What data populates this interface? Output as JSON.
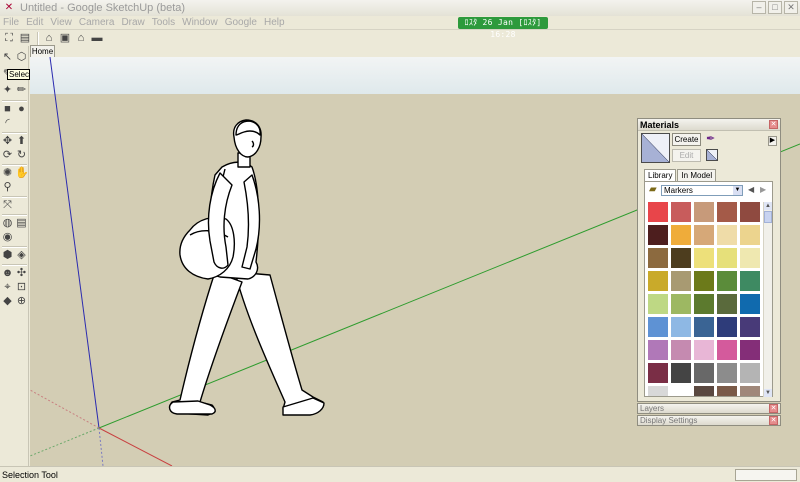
{
  "window": {
    "title": "Untitled - Google SketchUp (beta)",
    "icon": "sketchup-logo-icon",
    "buttons": [
      "minimize-icon",
      "maximize-icon",
      "close-icon"
    ]
  },
  "menubar": [
    "File",
    "Edit",
    "View",
    "Camera",
    "Draw",
    "Tools",
    "Window",
    "Google",
    "Help"
  ],
  "clock": "ﾛｽﾀ 26 Jan  [ﾛｽﾀ]  16:28",
  "scene_tabs": [
    "Home"
  ],
  "tooltip": "Select",
  "statusbar": {
    "text": "Selection Tool",
    "measurements_value": ""
  },
  "colors": {
    "ground": "#d3cdb4",
    "sky": "#dfe9ec",
    "red_axis": "#c84040",
    "green_axis": "#2e9c2e",
    "blue_axis": "#2b2bb0",
    "clock_bg": "#2d9a3c"
  },
  "materials": {
    "title": "Materials",
    "create_label": "Create",
    "edit_label": "Edit",
    "tabs": [
      "Library",
      "In Model"
    ],
    "active_tab": "Library",
    "collection": "Markers",
    "swatches": [
      "#e8454a",
      "#c85c5c",
      "#c79a7a",
      "#a45a48",
      "#8f4a40",
      "#4d1e1e",
      "#efac3a",
      "#d6a878",
      "#efdca8",
      "#ecd48e",
      "#8c6a3f",
      "#4d3d1e",
      "#ede07a",
      "#e6e07a",
      "#efe8b0",
      "#c9aa2a",
      "#a89a72",
      "#6c7a1a",
      "#5b8c3a",
      "#3e8a62",
      "#bed884",
      "#9db862",
      "#5c7a2e",
      "#5a6a3c",
      "#106aae",
      "#5e92d4",
      "#8eb8e4",
      "#3a6494",
      "#2e3c7a",
      "#483a78",
      "#b078b8",
      "#c58ab0",
      "#e8b6d6",
      "#d45a9c",
      "#842e78",
      "#7a2e46",
      "#444444",
      "#686868",
      "#8c8c8c",
      "#b4b4b4",
      "#d8d8d8",
      "#ffffff",
      "#5a4840",
      "#7a5a48",
      "#a0887a"
    ]
  },
  "panels": [
    {
      "label": "Layers"
    },
    {
      "label": "Display Settings"
    }
  ]
}
